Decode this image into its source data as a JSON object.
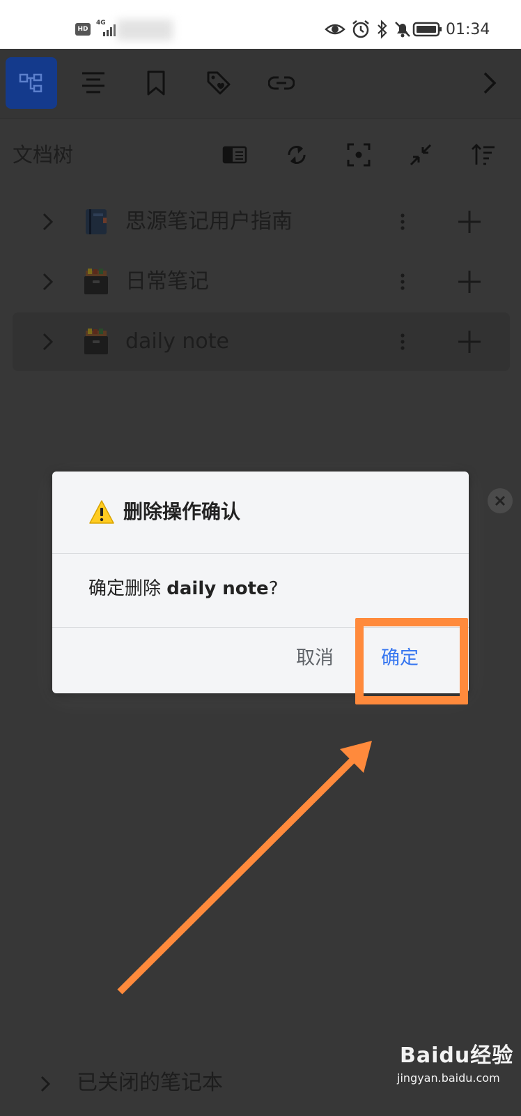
{
  "status_bar": {
    "hd": "HD",
    "network": "4G",
    "time": "01:34"
  },
  "toolbar": {
    "tabs": [
      "file-tree",
      "outline",
      "bookmarks",
      "tags",
      "backlinks"
    ],
    "active_color": "#143a8c"
  },
  "tree": {
    "title": "文档树",
    "notebooks": [
      {
        "label": "思源笔记用户指南",
        "icon": "book-icon"
      },
      {
        "label": "日常笔记",
        "icon": "file-box-icon"
      },
      {
        "label": "daily note",
        "icon": "file-box-icon",
        "selected": true
      }
    ],
    "closed_label": "已关闭的笔记本"
  },
  "dialog": {
    "title": "删除操作确认",
    "message_prefix": "确定删除 ",
    "message_target": "daily note",
    "message_suffix": "?",
    "cancel": "取消",
    "confirm": "确定",
    "confirm_color": "#3575f0",
    "highlight_color": "#ff8a3c"
  },
  "watermark": {
    "logo": "Baidu经验",
    "url": "jingyan.baidu.com"
  }
}
